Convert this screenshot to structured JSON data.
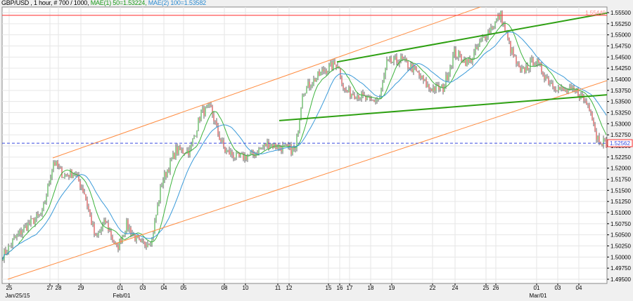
{
  "header": {
    "symbol": "GBP/USD , 1 hour, # 700 / 1000,",
    "ma1": "MAE(1) 50=1.53224,",
    "ma2": "MAE(2) 100=1.53582"
  },
  "chart_data": {
    "type": "candlestick",
    "symbol": "GBP/USD",
    "timeframe": "1 hour",
    "ylim": [
      1.495,
      1.555
    ],
    "y_ticks": [
      "1.55500",
      "1.55250",
      "1.55000",
      "1.54750",
      "1.54500",
      "1.54250",
      "1.54000",
      "1.53750",
      "1.53500",
      "1.53250",
      "1.53000",
      "1.52750",
      "1.52500",
      "1.52250",
      "1.52000",
      "1.51750",
      "1.51500",
      "1.51250",
      "1.51000",
      "1.50750",
      "1.50500",
      "1.50250",
      "1.50000",
      "1.49750",
      "1.49500"
    ],
    "bar_count": 430,
    "x_ticks": [
      {
        "bar": 5,
        "label": "25"
      },
      {
        "bar": 34,
        "label": "27"
      },
      {
        "bar": 40,
        "label": "28"
      },
      {
        "bar": 56,
        "label": "29"
      },
      {
        "bar": 84,
        "label": "01"
      },
      {
        "bar": 100,
        "label": "03"
      },
      {
        "bar": 115,
        "label": "04"
      },
      {
        "bar": 129,
        "label": "05"
      },
      {
        "bar": 158,
        "label": "08"
      },
      {
        "bar": 173,
        "label": "10"
      },
      {
        "bar": 196,
        "label": "11"
      },
      {
        "bar": 204,
        "label": "12"
      },
      {
        "bar": 232,
        "label": "15"
      },
      {
        "bar": 240,
        "label": "16"
      },
      {
        "bar": 247,
        "label": "17"
      },
      {
        "bar": 262,
        "label": "18"
      },
      {
        "bar": 277,
        "label": "19"
      },
      {
        "bar": 306,
        "label": "22"
      },
      {
        "bar": 322,
        "label": "24"
      },
      {
        "bar": 344,
        "label": "25"
      },
      {
        "bar": 351,
        "label": "26"
      },
      {
        "bar": 380,
        "label": "01"
      },
      {
        "bar": 395,
        "label": "03"
      },
      {
        "bar": 410,
        "label": "04"
      }
    ],
    "month_labels": [
      {
        "bar": 10,
        "label": "Jan/25/15"
      },
      {
        "bar": 84,
        "label": "Feb/01"
      },
      {
        "bar": 380,
        "label": "Mar/01"
      }
    ],
    "close_path": [
      [
        0,
        1.5005
      ],
      [
        2,
        1.501
      ],
      [
        8,
        1.504
      ],
      [
        18,
        1.5073
      ],
      [
        28,
        1.5097
      ],
      [
        36,
        1.5215
      ],
      [
        43,
        1.5184
      ],
      [
        51,
        1.519
      ],
      [
        58,
        1.5144
      ],
      [
        66,
        1.504
      ],
      [
        73,
        1.508
      ],
      [
        81,
        1.5018
      ],
      [
        88,
        1.5073
      ],
      [
        98,
        1.5026
      ],
      [
        106,
        1.504
      ],
      [
        113,
        1.5168
      ],
      [
        123,
        1.5239
      ],
      [
        133,
        1.5239
      ],
      [
        141,
        1.5326
      ],
      [
        148,
        1.5334
      ],
      [
        153,
        1.5278
      ],
      [
        158,
        1.5239
      ],
      [
        168,
        1.5223
      ],
      [
        178,
        1.5231
      ],
      [
        188,
        1.5255
      ],
      [
        198,
        1.5247
      ],
      [
        208,
        1.5239
      ],
      [
        213,
        1.5373
      ],
      [
        221,
        1.5397
      ],
      [
        228,
        1.542
      ],
      [
        238,
        1.5436
      ],
      [
        243,
        1.5373
      ],
      [
        253,
        1.5365
      ],
      [
        261,
        1.5349
      ],
      [
        268,
        1.5357
      ],
      [
        273,
        1.5436
      ],
      [
        283,
        1.5444
      ],
      [
        293,
        1.542
      ],
      [
        303,
        1.538
      ],
      [
        313,
        1.538
      ],
      [
        321,
        1.546
      ],
      [
        331,
        1.5436
      ],
      [
        343,
        1.5499
      ],
      [
        354,
        1.5544
      ],
      [
        361,
        1.5468
      ],
      [
        368,
        1.5413
      ],
      [
        378,
        1.5444
      ],
      [
        388,
        1.5397
      ],
      [
        398,
        1.5373
      ],
      [
        408,
        1.5373
      ],
      [
        418,
        1.5334
      ],
      [
        422,
        1.5271
      ],
      [
        429,
        1.5256
      ]
    ],
    "moving_averages": [
      {
        "name": "MAE(1) 50",
        "value": 1.53224,
        "color": "#3cb33c",
        "period_bars": 12
      },
      {
        "name": "MAE(2) 100",
        "value": 1.53582,
        "color": "#3a9ad9",
        "period_bars": 25
      }
    ],
    "lines": [
      {
        "name": "channel-upper",
        "color": "#ff8c40",
        "p1": [
          36,
          1.5223
        ],
        "p2": [
          343,
          1.5566
        ]
      },
      {
        "name": "channel-lower",
        "color": "#ff8c40",
        "p1": [
          4,
          1.495
        ],
        "p2": [
          430,
          1.5397
        ]
      },
      {
        "name": "wedge-upper",
        "color": "#2ea012",
        "p1": [
          238,
          1.5439
        ],
        "p2": [
          430,
          1.5549
        ]
      },
      {
        "name": "wedge-lower",
        "color": "#2ea012",
        "p1": [
          197,
          1.5307
        ],
        "p2": [
          430,
          1.5365
        ]
      }
    ],
    "horizontal_level": {
      "value": 1.5544,
      "label": "1.55440",
      "color": "#ff4040"
    },
    "current_price": {
      "value": 1.52562,
      "label": "1.52562",
      "color": "#3a4ae0"
    }
  }
}
